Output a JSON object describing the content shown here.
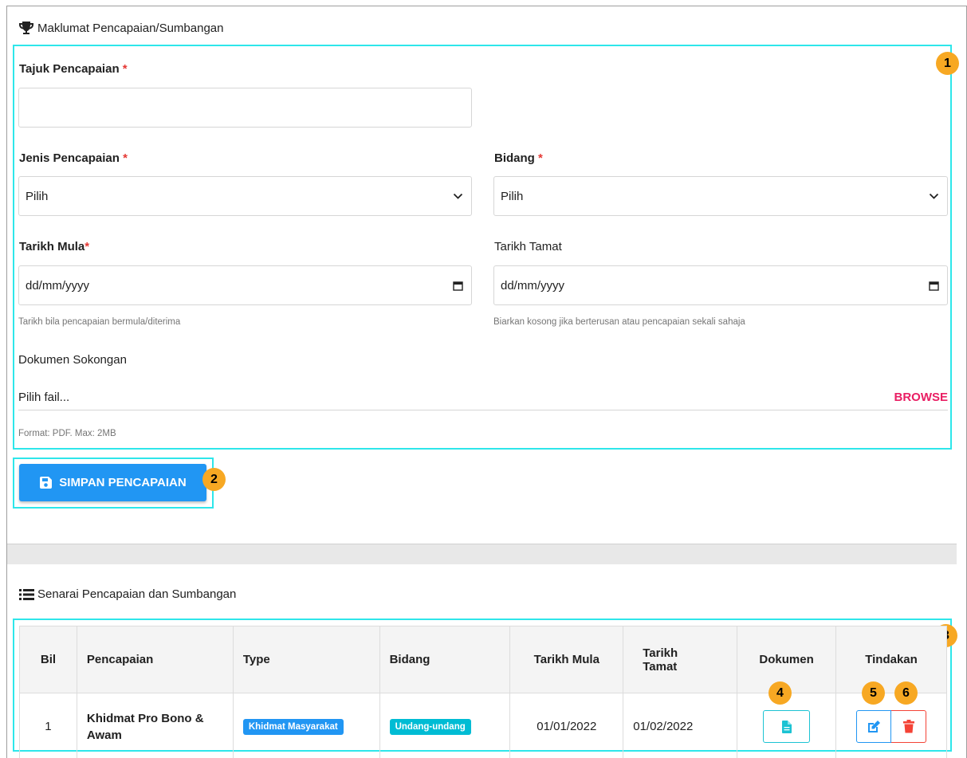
{
  "form_section": {
    "title": "Maklumat Pencapaian/Sumbangan",
    "tajuk_label": "Tajuk Pencapaian",
    "tajuk_value": "",
    "jenis_label": "Jenis Pencapaian",
    "jenis_value": "Pilih",
    "bidang_label": "Bidang",
    "bidang_value": "Pilih",
    "mula_label": "Tarikh Mula",
    "mula_value": "dd/mm/yyyy",
    "mula_help": "Tarikh bila pencapaian bermula/diterima",
    "tamat_label": "Tarikh Tamat",
    "tamat_value": "dd/mm/yyyy",
    "tamat_help": "Biarkan kosong jika berterusan atau pencapaian sekali sahaja",
    "dokumen_label": "Dokumen Sokongan",
    "file_placeholder": "Pilih fail...",
    "browse_label": "BROWSE",
    "file_help": "Format: PDF. Max: 2MB",
    "required_mark": "*"
  },
  "save_button_label": "SIMPAN PENCAPAIAN",
  "list_section": {
    "title": "Senarai Pencapaian dan Sumbangan",
    "columns": [
      "Bil",
      "Pencapaian",
      "Type",
      "Bidang",
      "Tarikh Mula",
      "Tarikh Tamat",
      "Dokumen",
      "Tindakan"
    ],
    "rows": [
      {
        "bil": "1",
        "pencapaian": "Khidmat Pro Bono & Awam",
        "type": "Khidmat Masyarakat",
        "bidang": "Undang-undang",
        "tarikh_mula": "01/01/2022",
        "tarikh_tamat": "01/02/2022"
      }
    ]
  },
  "annotations": [
    "1",
    "2",
    "3",
    "4",
    "5",
    "6"
  ],
  "colors": {
    "primary": "#2196f3",
    "info": "#00bcd4",
    "danger": "#f44336",
    "accent": "#e91e63",
    "highlight": "#2ee6ea",
    "badge": "#f7a823"
  },
  "icons": [
    "trophy-icon",
    "chevron-down-icon",
    "calendar-icon",
    "save-icon",
    "list-icon",
    "file-icon",
    "edit-icon",
    "trash-icon"
  ]
}
